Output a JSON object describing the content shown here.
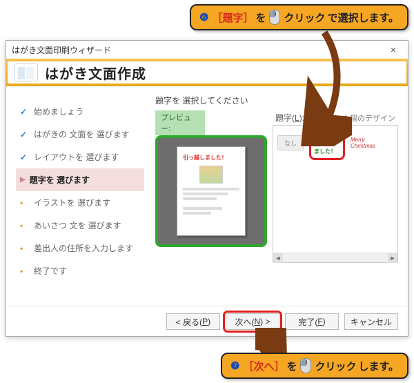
{
  "callout_top": {
    "num": "❻",
    "bracket": "［題字］",
    "pre": "を",
    "mouse": "mouse-icon",
    "action": "クリック",
    "post": "で選択します。"
  },
  "callout_bottom": {
    "num": "❼",
    "bracket": "［次へ］",
    "pre": "を",
    "mouse": "mouse-icon",
    "action": "クリック",
    "post": "します。"
  },
  "dialog": {
    "title": "はがき文面印刷ウィザード",
    "header": "はがき文面作成",
    "close": "×"
  },
  "steps": [
    {
      "label": "始めましょう",
      "state": "done"
    },
    {
      "label": "はがきの 文面を 選びます",
      "state": "done"
    },
    {
      "label": "レイアウトを 選びます",
      "state": "done"
    },
    {
      "label": "題字を 選びます",
      "state": "current"
    },
    {
      "label": "イラストを 選びます",
      "state": "pending"
    },
    {
      "label": "あいさつ 文を 選びます",
      "state": "pending"
    },
    {
      "label": "差出人の住所を入力します",
      "state": "pending"
    },
    {
      "label": "終了です",
      "state": "pending"
    }
  ],
  "right": {
    "instruction": "題字を 選択してください",
    "preview_label": "プレビュー:",
    "card_title": "引っ越しました！",
    "daiji_label_pre": "題字(",
    "daiji_label_key": "L",
    "daiji_label_post": "):",
    "count": "3 個のデザイン",
    "thumbs": {
      "none": "なし",
      "t2": "引っ越しました！",
      "t3": "Merry Christmas"
    }
  },
  "buttons": {
    "back_pre": "< 戻る(",
    "back_key": "P",
    "back_post": ")",
    "next_pre": "次へ(",
    "next_key": "N",
    "next_post": ") >",
    "finish_pre": "完了(",
    "finish_key": "F",
    "finish_post": ")",
    "cancel": "キャンセル"
  }
}
